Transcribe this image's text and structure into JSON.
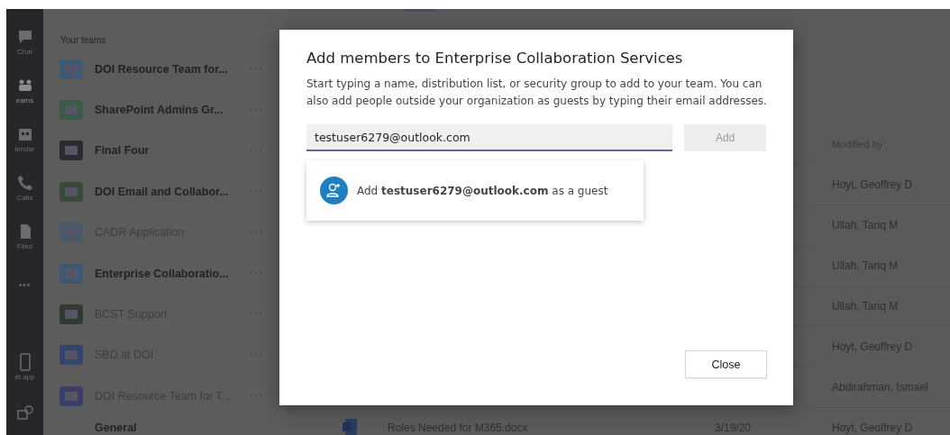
{
  "app_rail": {
    "items": [
      {
        "label": "Chat",
        "kind": "chat",
        "selected": false
      },
      {
        "label": "eams",
        "kind": "teams",
        "selected": true
      },
      {
        "label": "lendar",
        "kind": "calendar",
        "selected": false
      },
      {
        "label": "Calls",
        "kind": "calls",
        "selected": false
      },
      {
        "label": "Files",
        "kind": "files",
        "selected": false
      },
      {
        "label": "•••",
        "kind": "more",
        "selected": false
      }
    ],
    "bottom_items": [
      {
        "label": "et app",
        "kind": "phone"
      },
      {
        "kind": "apps"
      }
    ]
  },
  "teams_panel": {
    "heading": "Your teams",
    "teams": [
      {
        "name": "DOI Resource Team for...",
        "unread": true,
        "menu": "···"
      },
      {
        "name": "SharePoint Admins Gr...",
        "unread": true,
        "menu": "···"
      },
      {
        "name": "Final Four",
        "unread": true,
        "menu": "···"
      },
      {
        "name": "DOI Email and Collabor...",
        "unread": true,
        "menu": "···"
      },
      {
        "name": "CADR Application",
        "unread": false,
        "menu": "···"
      },
      {
        "name": "Enterprise Collaboratio...",
        "unread": true,
        "menu": "···"
      },
      {
        "name": "BCST Support",
        "unread": false,
        "menu": "···"
      },
      {
        "name": "SBD at DOI",
        "unread": false,
        "menu": "···"
      },
      {
        "name": "DOI Resource Team for T...",
        "unread": false,
        "menu": "···",
        "children": [
          {
            "name": "General",
            "unread": true
          }
        ]
      }
    ]
  },
  "files": {
    "header": {
      "modified_by": "Modified by"
    },
    "rows": [
      {
        "modified_by": "Hoyt, Geoffrey D"
      },
      {
        "modified_by": "Ullah, Tariq M"
      },
      {
        "modified_by": "Ullah, Tariq M"
      },
      {
        "modified_by": "Ullah, Tariq M"
      },
      {
        "modified_by": "Hoyt, Geoffrey D"
      },
      {
        "modified_by": "Abdirahman, Ismael"
      },
      {
        "name": "Roles Needed for M365.docx",
        "modified": "3/19/20",
        "modified_by": "Hoyt, Geoffrey D"
      }
    ]
  },
  "dialog": {
    "title": "Add members to Enterprise Collaboration Services",
    "description": "Start typing a name, distribution list, or security group to add to your team. You can also add people outside your organization as guests by typing their email addresses.",
    "input": {
      "value": "testuser6279@outlook.com"
    },
    "add_button": {
      "label": "Add",
      "disabled": true
    },
    "suggestions": [
      {
        "text": "Add **testuser6279@outlook.com** as a guest"
      }
    ],
    "close_button": "Close"
  }
}
